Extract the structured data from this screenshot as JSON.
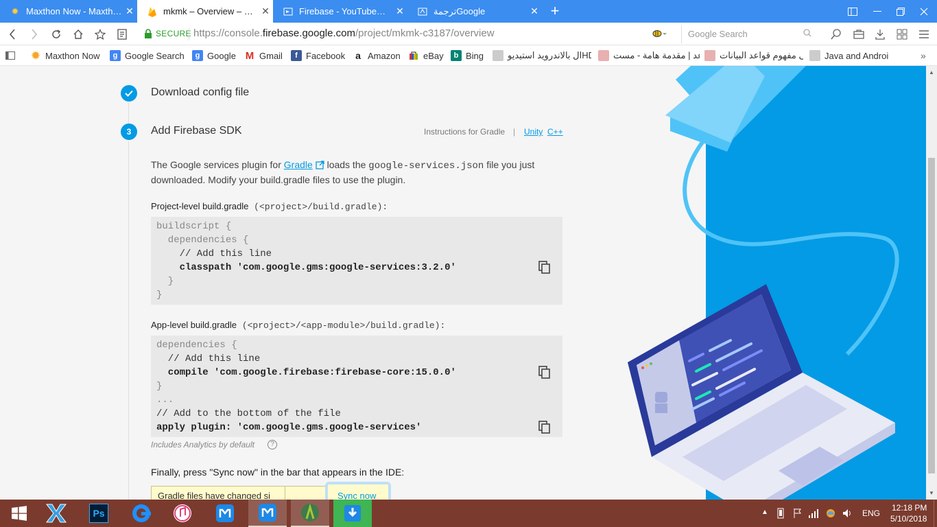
{
  "browser": {
    "tabs": [
      {
        "title": "Maxthon Now - Maxth…",
        "icon": "sun-icon",
        "active": false
      },
      {
        "title": "mkmk – Overview – Fir…",
        "icon": "firebase-icon",
        "active": true
      },
      {
        "title": "Firebase - YouTubeربط…",
        "icon": "youtube-icon",
        "active": false
      },
      {
        "title": "ترجمةGoogle",
        "icon": "translate-icon",
        "active": false
      }
    ],
    "new_tab": "+",
    "address": {
      "secure_label": "SECURE",
      "url_prefix": "https://console.",
      "url_domain": "firebase.google.com",
      "url_path": "/project/mkmk-c3187/overview"
    },
    "search": {
      "placeholder": "Google Search"
    }
  },
  "bookmarks": [
    {
      "label": "Maxthon Now",
      "icon": "sun-icon",
      "color": "#f5a623"
    },
    {
      "label": "Google Search",
      "icon": "g-icon",
      "color": "#4285f4"
    },
    {
      "label": "Google",
      "icon": "g-icon",
      "color": "#4285f4"
    },
    {
      "label": "Gmail",
      "icon": "gmail-icon",
      "color": "#d93025"
    },
    {
      "label": "Facebook",
      "icon": "facebook-icon",
      "color": "#3b5998"
    },
    {
      "label": "Amazon",
      "icon": "amazon-icon",
      "color": "#222222"
    },
    {
      "label": "eBay",
      "icon": "ebay-icon",
      "color": "#e53238"
    },
    {
      "label": "Bing",
      "icon": "bing-icon",
      "color": "#008373"
    },
    {
      "label": "ال بالاندرويد استيديوHD -…",
      "icon": "page-icon",
      "color": "#999999"
    },
    {
      "label": "الاعد | مقدمة هامة - مست…",
      "icon": "page-icon",
      "color": "#cc3333"
    },
    {
      "label": "على مفهوم قواعد البيانات-…",
      "icon": "page-icon",
      "color": "#cc3333"
    },
    {
      "label": "Java and Androi",
      "icon": "page-icon",
      "color": "#999999"
    }
  ],
  "page": {
    "step_done": {
      "title": "Download config file"
    },
    "step3": {
      "number": "3",
      "title": "Add Firebase SDK",
      "instructions": "Instructions for Gradle",
      "divider": "|",
      "link_unity": "Unity",
      "link_cpp": "C++"
    },
    "intro": {
      "text1": "The Google services plugin for ",
      "gradle_link": "Gradle",
      "text2": " loads the ",
      "filename": "google-services.json",
      "text3": " file you just",
      "line2": "downloaded. Modify your build.gradle files to use the plugin."
    },
    "project_level": {
      "label": "Project-level build.gradle",
      "path": " (<project>/build.gradle):",
      "code": [
        "buildscript {",
        "  dependencies {",
        "    // Add this line",
        "    classpath 'com.google.gms:google-services:3.2.0'",
        "  }",
        "}"
      ]
    },
    "app_level": {
      "label": "App-level build.gradle",
      "path": " (<project>/<app-module>/build.gradle):",
      "code": [
        "dependencies {",
        "  // Add this line",
        "  compile 'com.google.firebase:firebase-core:15.0.0'",
        "}",
        "...",
        "// Add to the bottom of the file",
        "apply plugin: 'com.google.gms.google-services'"
      ]
    },
    "analytics_note": "Includes Analytics by default",
    "help_icon": "?",
    "finally": "Finally, press \"Sync now\" in the bar that appears in the IDE:",
    "gradle_bar": {
      "text": "Gradle files have changed si",
      "sync": "Sync now"
    }
  },
  "taskbar": {
    "apps": [
      "windows-start-icon",
      "maxthon-x-icon",
      "photoshop-icon",
      "edge-icon",
      "itunes-icon",
      "maxthon-icon",
      "maxthon-active-icon",
      "android-studio-icon",
      "download-icon"
    ],
    "photoshop_label": "Ps",
    "tray": {
      "lang": "ENG",
      "time": "12:18 PM",
      "date": "5/10/2018"
    }
  }
}
